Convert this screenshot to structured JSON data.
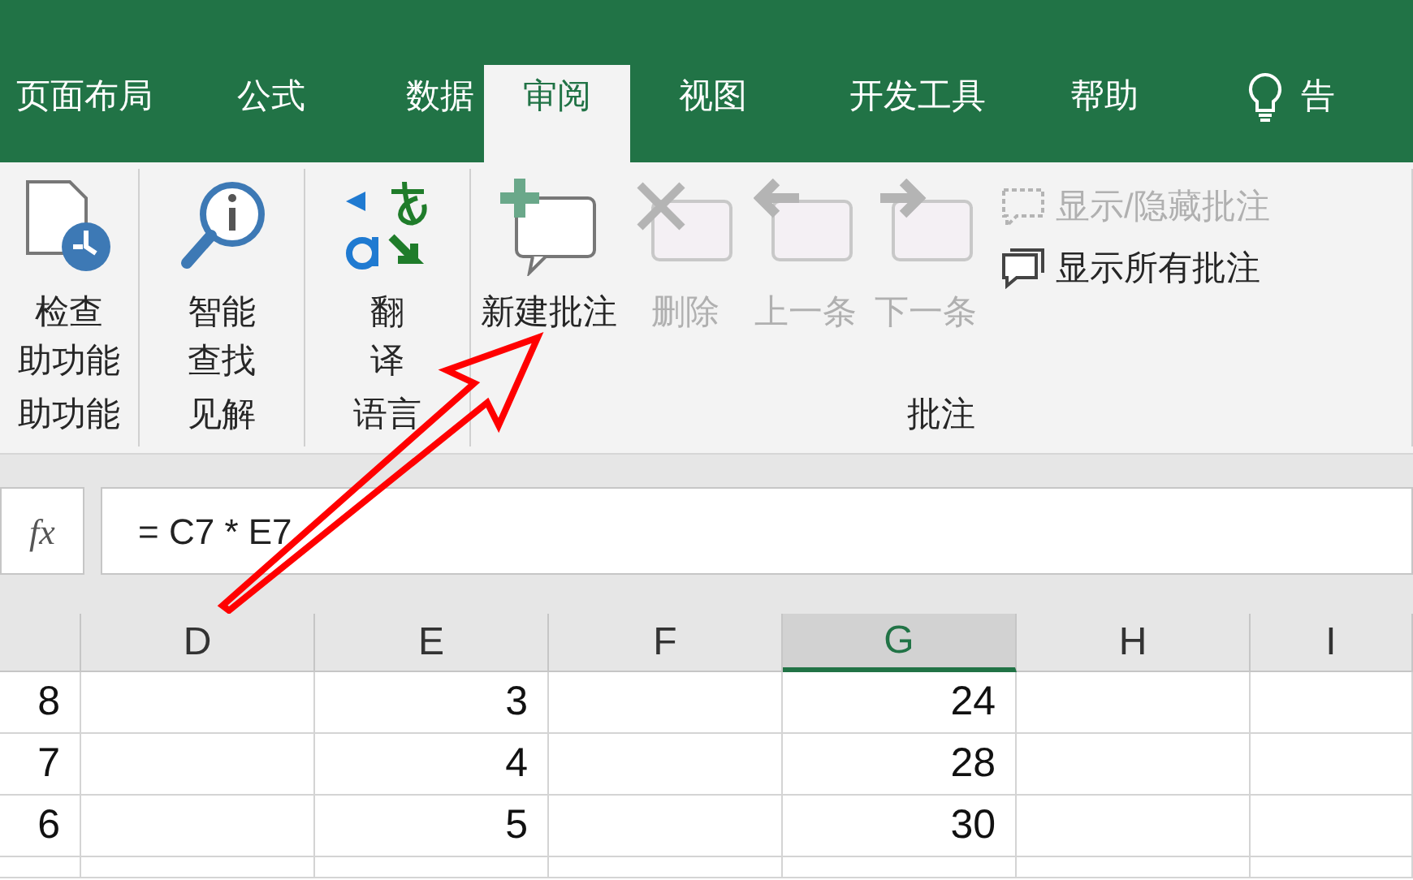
{
  "tabs": [
    {
      "label": "页面布局",
      "selected": false
    },
    {
      "label": "公式",
      "selected": false
    },
    {
      "label": "数据",
      "selected": false
    },
    {
      "label": "审阅",
      "selected": true
    },
    {
      "label": "视图",
      "selected": false
    },
    {
      "label": "开发工具",
      "selected": false
    },
    {
      "label": "帮助",
      "selected": false
    }
  ],
  "tell_me": {
    "label": "告"
  },
  "ribbon": {
    "groups": [
      {
        "label": "助功能",
        "buttons": [
          {
            "kind": "large",
            "lines": [
              "检查",
              "助功能"
            ],
            "disabled": false
          }
        ]
      },
      {
        "label": "见解",
        "buttons": [
          {
            "kind": "large",
            "lines": [
              "智能",
              "查找"
            ],
            "disabled": false
          }
        ]
      },
      {
        "label": "语言",
        "buttons": [
          {
            "kind": "large",
            "lines": [
              "翻",
              "译"
            ],
            "disabled": false
          }
        ]
      },
      {
        "label": "批注",
        "buttons": [
          {
            "kind": "large",
            "label": "新建批注",
            "disabled": false
          },
          {
            "kind": "large",
            "label": "删除",
            "disabled": true
          },
          {
            "kind": "large",
            "label": "上一条",
            "disabled": true
          },
          {
            "kind": "large",
            "label": "下一条",
            "disabled": true
          },
          {
            "kind": "small",
            "label": "显示/隐藏批注",
            "disabled": true
          },
          {
            "kind": "small",
            "label": "显示所有批注",
            "disabled": false
          }
        ]
      }
    ]
  },
  "formula_bar": {
    "fx": "fx",
    "formula": "= C7 * E7"
  },
  "sheet": {
    "columns": [
      {
        "selected": false
      },
      {
        "label": "D",
        "selected": false
      },
      {
        "label": "E",
        "selected": false
      },
      {
        "label": "F",
        "selected": false
      },
      {
        "label": "G",
        "selected": true
      },
      {
        "label": "H",
        "selected": false
      },
      {
        "label": "I",
        "selected": false
      }
    ],
    "rows": [
      {
        "cells": [
          "8",
          "",
          "3",
          "",
          "24",
          "",
          ""
        ]
      },
      {
        "cells": [
          "7",
          "",
          "4",
          "",
          "28",
          "",
          ""
        ]
      },
      {
        "cells": [
          "6",
          "",
          "5",
          "",
          "30",
          "",
          ""
        ]
      }
    ]
  }
}
